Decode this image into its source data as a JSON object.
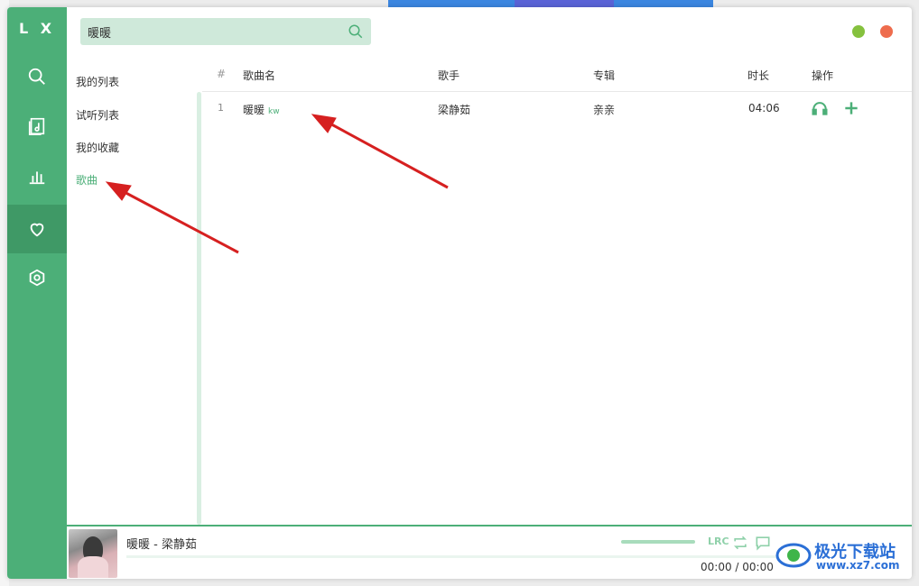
{
  "app": {
    "logo": "L X"
  },
  "sidebar": {
    "items": [
      {
        "name": "search",
        "icon": "search-icon"
      },
      {
        "name": "songlist",
        "icon": "music-file-icon"
      },
      {
        "name": "leaderboard",
        "icon": "chart-icon"
      },
      {
        "name": "my-list",
        "icon": "heart-icon",
        "active": true
      },
      {
        "name": "settings",
        "icon": "settings-icon"
      }
    ]
  },
  "search": {
    "value": "暖暖"
  },
  "lists": {
    "header": "我的列表",
    "items": [
      {
        "label": "试听列表"
      },
      {
        "label": "我的收藏"
      },
      {
        "label": "歌曲",
        "active": true
      }
    ]
  },
  "table": {
    "headers": {
      "index": "#",
      "name": "歌曲名",
      "singer": "歌手",
      "album": "专辑",
      "duration": "时长",
      "actions": "操作"
    },
    "rows": [
      {
        "index": "1",
        "name": "暖暖",
        "source": "kw",
        "singer": "梁静茹",
        "album": "亲亲",
        "duration": "04:06"
      }
    ]
  },
  "player": {
    "title": "暖暖 - 梁静茹",
    "time": "00:00 / 00:00",
    "lrc_label": "LRC"
  },
  "watermark": {
    "name": "极光下载站",
    "url": "www.xz7.com"
  },
  "colors": {
    "accent": "#4caf78",
    "accent_dark": "#3f9966",
    "search_bg": "#cfe9da",
    "annotation_arrow": "#d62020"
  }
}
